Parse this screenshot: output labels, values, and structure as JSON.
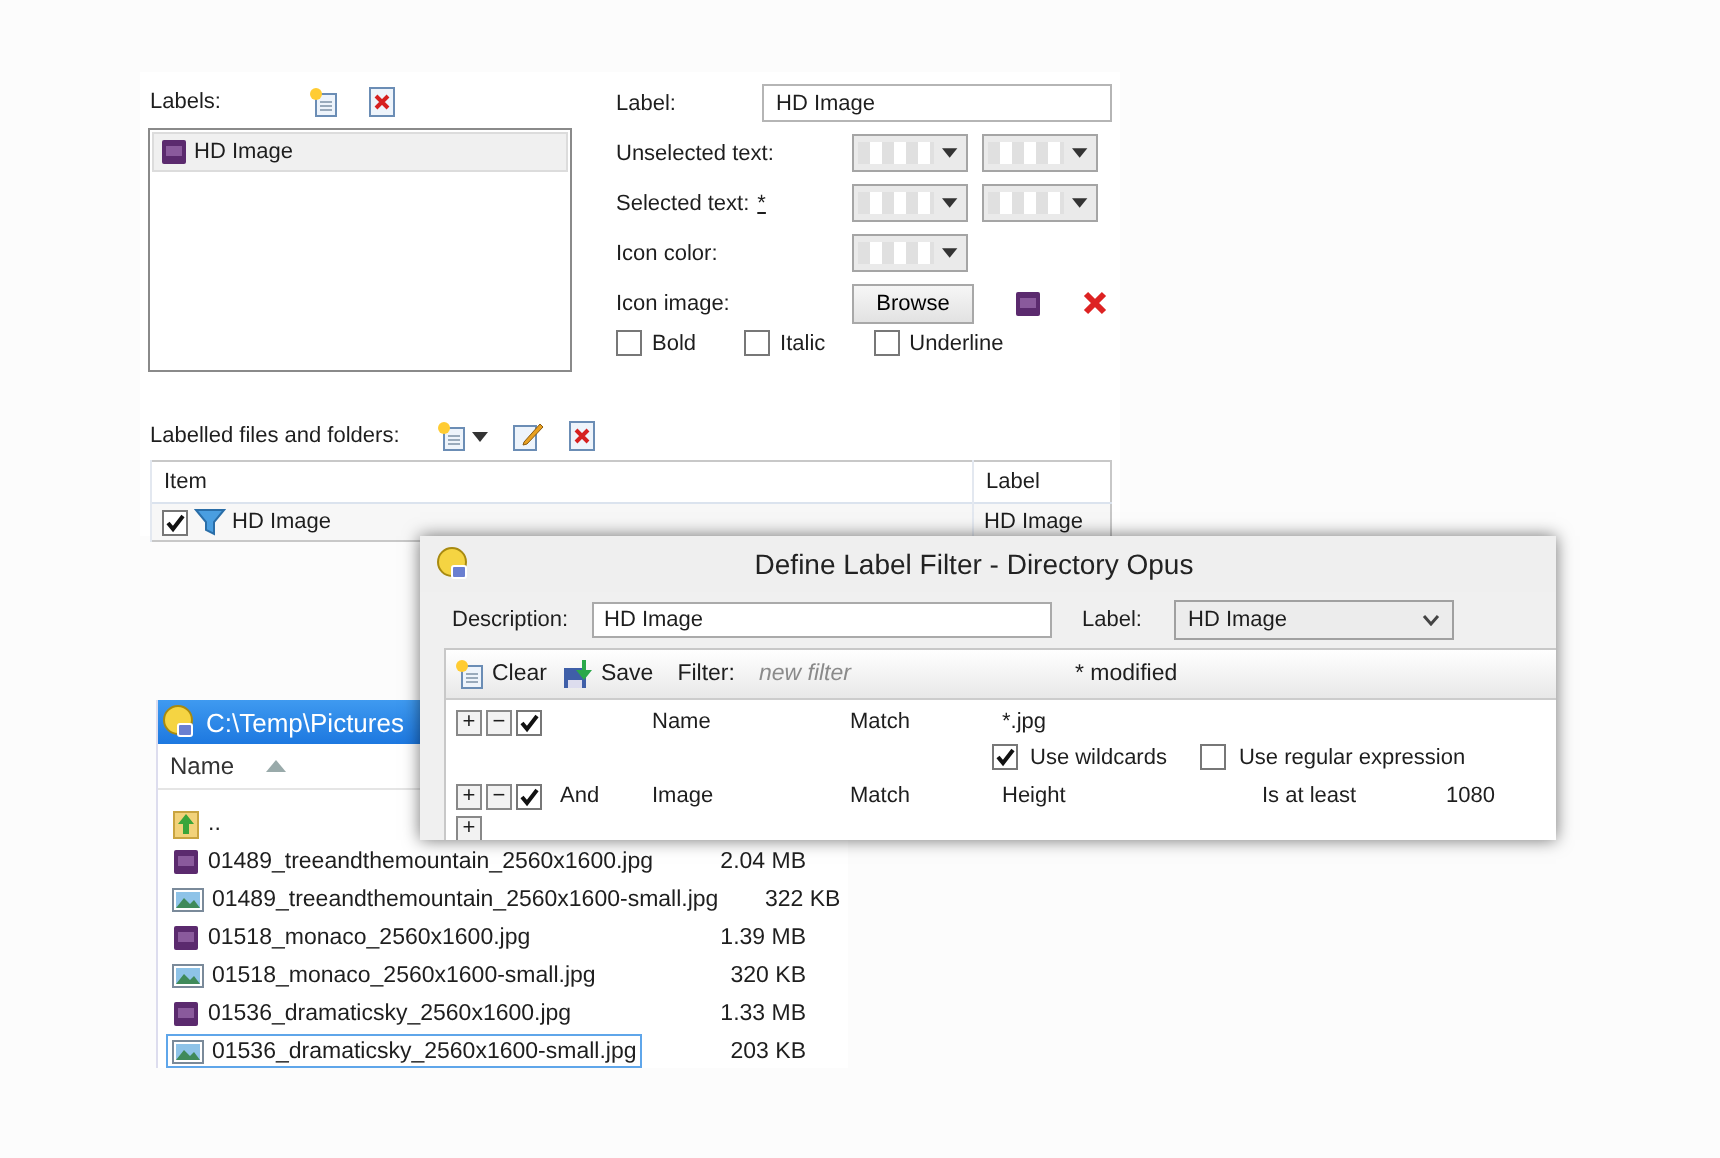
{
  "labels_panel": {
    "labels_caption": "Labels:",
    "labels": [
      {
        "name": "HD Image",
        "selected": true
      }
    ],
    "label_field": {
      "label": "Label:",
      "value": "HD Image"
    },
    "color_rows": [
      {
        "label": "Unselected text:",
        "kind": "pair"
      },
      {
        "label": "Selected text:",
        "marker": "*",
        "kind": "pair"
      },
      {
        "label": "Icon color:",
        "kind": "single"
      }
    ],
    "icon_image": {
      "label": "Icon image:",
      "button": "Browse"
    },
    "styles": [
      {
        "label": "Bold",
        "checked": false
      },
      {
        "label": "Italic",
        "checked": false
      },
      {
        "label": "Underline",
        "checked": false
      }
    ],
    "files_caption": "Labelled files and folders:",
    "table": {
      "columns": [
        "Item",
        "Label"
      ],
      "rows": [
        {
          "item": "HD Image",
          "label": "HD Image",
          "checked": true
        }
      ]
    }
  },
  "explorer": {
    "path": "C:\\Temp\\Pictures",
    "name_column": "Name",
    "files": [
      {
        "name": "..",
        "kind": "parent",
        "selected": false
      },
      {
        "name": "01489_treeandthemountain_2560x1600.jpg",
        "size": "2.04 MB",
        "kind": "hd",
        "selected": false
      },
      {
        "name": "01489_treeandthemountain_2560x1600-small.jpg",
        "size": "322 KB",
        "kind": "image",
        "selected": false
      },
      {
        "name": "01518_monaco_2560x1600.jpg",
        "size": "1.39 MB",
        "kind": "hd",
        "selected": false
      },
      {
        "name": "01518_monaco_2560x1600-small.jpg",
        "size": "320 KB",
        "kind": "image",
        "selected": false
      },
      {
        "name": "01536_dramaticsky_2560x1600.jpg",
        "size": "1.33 MB",
        "kind": "hd",
        "selected": false
      },
      {
        "name": "01536_dramaticsky_2560x1600-small.jpg",
        "size": "203 KB",
        "kind": "image",
        "selected": true
      }
    ]
  },
  "dialog": {
    "title": "Define Label Filter - Directory Opus",
    "description_label": "Description:",
    "description": "HD Image",
    "label_label": "Label:",
    "label_value": "HD Image",
    "toolbar": {
      "clear": "Clear",
      "save": "Save",
      "filter_label": "Filter:",
      "filter_placeholder": "new filter",
      "status": "* modified"
    },
    "rules": [
      {
        "add": "+",
        "remove": "−",
        "enabled": true,
        "field": "Name",
        "op": "Match",
        "value": "*.jpg",
        "options": [
          {
            "label": "Use wildcards",
            "checked": true
          },
          {
            "label": "Use regular expression",
            "checked": false
          }
        ]
      },
      {
        "add": "+",
        "remove": "−",
        "enabled": true,
        "conjunction": "And",
        "field": "Image",
        "op": "Match",
        "value": "Height",
        "condition": "Is at least",
        "amount": "1080"
      }
    ],
    "add_row": "+"
  }
}
